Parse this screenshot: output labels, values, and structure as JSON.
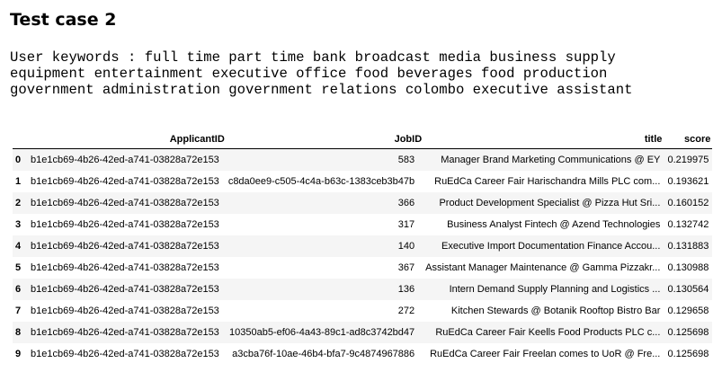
{
  "heading": "Test case 2",
  "keywords_lines": [
    "User keywords : full time part time bank broadcast media business supply",
    "equipment entertainment executive office food beverages food production",
    "government administration government relations colombo executive assistant"
  ],
  "table": {
    "columns": [
      "ApplicantID",
      "JobID",
      "title",
      "score"
    ],
    "rows": [
      {
        "index": "0",
        "applicant": "b1e1cb69-4b26-42ed-a741-03828a72e153",
        "job": "583",
        "title": "Manager Brand Marketing Communications @ EY",
        "score": "0.219975"
      },
      {
        "index": "1",
        "applicant": "b1e1cb69-4b26-42ed-a741-03828a72e153",
        "job": "c8da0ee9-c505-4c4a-b63c-1383ceb3b47b",
        "title": "RuEdCa Career Fair Harischandra Mills PLC com...",
        "score": "0.193621"
      },
      {
        "index": "2",
        "applicant": "b1e1cb69-4b26-42ed-a741-03828a72e153",
        "job": "366",
        "title": "Product Development Specialist @ Pizza Hut Sri...",
        "score": "0.160152"
      },
      {
        "index": "3",
        "applicant": "b1e1cb69-4b26-42ed-a741-03828a72e153",
        "job": "317",
        "title": "Business Analyst Fintech @ Azend Technologies",
        "score": "0.132742"
      },
      {
        "index": "4",
        "applicant": "b1e1cb69-4b26-42ed-a741-03828a72e153",
        "job": "140",
        "title": "Executive Import Documentation Finance Accou...",
        "score": "0.131883"
      },
      {
        "index": "5",
        "applicant": "b1e1cb69-4b26-42ed-a741-03828a72e153",
        "job": "367",
        "title": "Assistant Manager Maintenance @ Gamma Pizzakr...",
        "score": "0.130988"
      },
      {
        "index": "6",
        "applicant": "b1e1cb69-4b26-42ed-a741-03828a72e153",
        "job": "136",
        "title": "Intern Demand Supply Planning and Logistics ...",
        "score": "0.130564"
      },
      {
        "index": "7",
        "applicant": "b1e1cb69-4b26-42ed-a741-03828a72e153",
        "job": "272",
        "title": "Kitchen Stewards @ Botanik Rooftop Bistro Bar",
        "score": "0.129658"
      },
      {
        "index": "8",
        "applicant": "b1e1cb69-4b26-42ed-a741-03828a72e153",
        "job": "10350ab5-ef06-4a43-89c1-ad8c3742bd47",
        "title": "RuEdCa Career Fair Keells Food Products PLC c...",
        "score": "0.125698"
      },
      {
        "index": "9",
        "applicant": "b1e1cb69-4b26-42ed-a741-03828a72e153",
        "job": "a3cba76f-10ae-46b4-bfa7-9c4874967886",
        "title": "RuEdCa Career Fair Freelan comes to UoR @ Fre...",
        "score": "0.125698"
      }
    ]
  }
}
